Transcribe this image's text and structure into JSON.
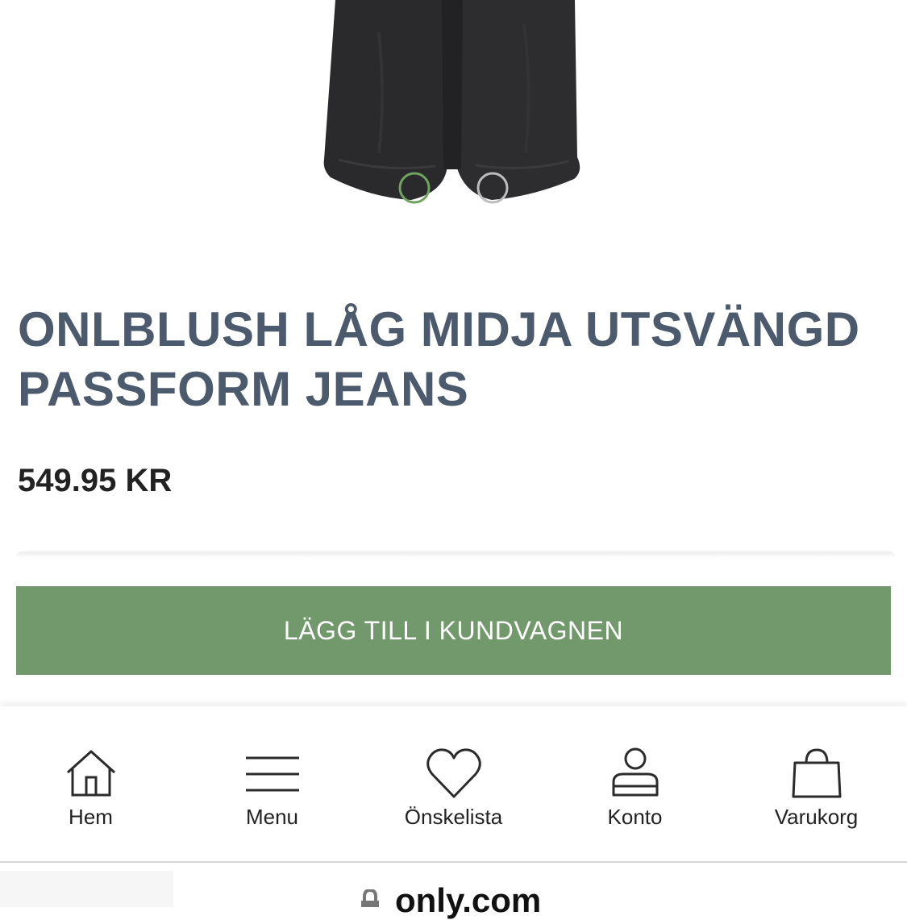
{
  "product": {
    "title": "ONLBLUSH LÅG MIDJA UTSVÄNGD PASSFORM JEANS",
    "price": "549.95 KR",
    "add_to_cart_label": "LÄGG TILL I KUNDVAGNEN",
    "carousel": {
      "slides": 2,
      "active_index": 0
    }
  },
  "colors": {
    "title": "#4b5a6d",
    "accent_green": "#72996b",
    "denim": "#2a2a2c"
  },
  "bottom_nav": [
    {
      "label": "Hem",
      "icon": "home-icon"
    },
    {
      "label": "Menu",
      "icon": "hamburger-icon"
    },
    {
      "label": "Önskelista",
      "icon": "heart-icon"
    },
    {
      "label": "Konto",
      "icon": "user-icon"
    },
    {
      "label": "Varukorg",
      "icon": "shopping-bag-icon"
    }
  ],
  "browser": {
    "url": "only.com",
    "icon": "lock-icon"
  }
}
